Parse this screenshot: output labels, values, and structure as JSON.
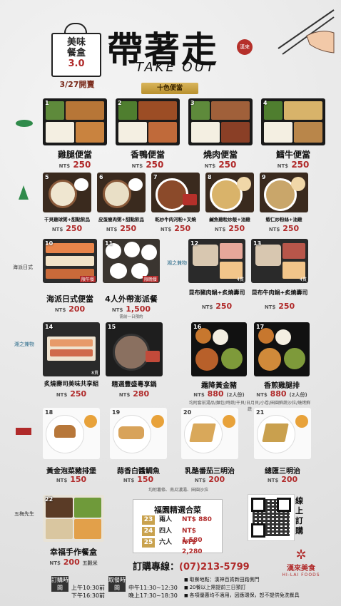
{
  "header": {
    "bag_line1": "美味",
    "bag_line2": "餐盒",
    "bag_line3": "3.0",
    "date": "3/27開賣",
    "title": "帶著走",
    "title_en": "TAKE OUT",
    "stamp": "漢來",
    "ribbon": "十色便當"
  },
  "row1": [
    {
      "num": "1",
      "name": "雞腿便當",
      "price": "250"
    },
    {
      "num": "2",
      "name": "香鴨便當",
      "price": "250"
    },
    {
      "num": "3",
      "name": "燒肉便當",
      "price": "250"
    },
    {
      "num": "4",
      "name": "鱈牛便當",
      "price": "250"
    }
  ],
  "row2": [
    {
      "num": "5",
      "name": "干貝雞球粥+甜點飲品",
      "price": "250"
    },
    {
      "num": "6",
      "name": "皮蛋瘦肉粥+甜點飲品",
      "price": "250"
    },
    {
      "num": "7",
      "name": "乾炒牛肉河粉+叉燒",
      "price": "250"
    },
    {
      "num": "8",
      "name": "鹹魚雞粒炒飯+油雞",
      "price": "250"
    },
    {
      "num": "9",
      "name": "蝦仁炒粉絲+油雞",
      "price": "250"
    }
  ],
  "row3": [
    {
      "num": "10",
      "name": "海派日式便當",
      "price": "200",
      "tag": "限午餐"
    },
    {
      "num": "11",
      "name": "4人外帶澎派餐",
      "price": "1,500",
      "tag": "限晚餐",
      "note": "需前一日預約"
    },
    {
      "num": "12",
      "name": "昆布豬肉鍋+炙燒壽司",
      "price": "250",
      "tag": "4貫"
    },
    {
      "num": "13",
      "name": "昆布牛肉鍋+炙燒壽司",
      "price": "250",
      "tag": "4貫"
    }
  ],
  "row4": [
    {
      "num": "14",
      "name": "炙燒壽司美味共享組",
      "price": "250",
      "tag": "8貫"
    },
    {
      "num": "15",
      "name": "精選豐盛粵享鍋",
      "price": "280"
    },
    {
      "num": "16",
      "name": "霜降黃金豬",
      "price": "880",
      "unit": "(2人份)"
    },
    {
      "num": "17",
      "name": "香煎雞腿排",
      "price": "880",
      "unit": "(2人份)"
    }
  ],
  "row4_note": "均附套前湯品/麵包/時蔬/干貝/日月貝/小卷/田園鮮蔬沙拉/燒烤鮮蔬",
  "row5": [
    {
      "num": "18",
      "name": "黃金泡菜豬排堡",
      "price": "150"
    },
    {
      "num": "19",
      "name": "蒜香白醬鯛魚",
      "price": "150"
    },
    {
      "num": "20",
      "name": "乳酪番茄三明治",
      "price": "200"
    },
    {
      "num": "21",
      "name": "總匯三明治",
      "price": "200"
    }
  ],
  "row5_note": "均附薯條、南瓜濃湯、田園沙拉",
  "bottom_left": {
    "num": "22",
    "name": "幸福手作餐盒",
    "price": "200",
    "unit": "五穀米"
  },
  "restaurant_logos": [
    "海派日式",
    "湘之兼物",
    "湘之兼物",
    "福園",
    "五梅先生"
  ],
  "combo": {
    "title": "福園精選合菜",
    "rows": [
      {
        "num": "23",
        "label": "兩人",
        "price": "880"
      },
      {
        "num": "24",
        "label": "四人",
        "price": "1,580"
      },
      {
        "num": "25",
        "label": "六人",
        "price": "2,280"
      }
    ]
  },
  "currency": "NT$",
  "order_online": "線上訂購",
  "hotline_label": "訂購專線：",
  "hotline": "(07)213-5799",
  "brand": {
    "zh": "漢來美食",
    "en": "HI-LAI FOODS"
  },
  "order_hours": {
    "label": "訂購時間",
    "am": "上午10:30前",
    "pm": "下午16:30前"
  },
  "pickup_hours": {
    "label": "取餐時間",
    "noon": "中午11:30~12:30",
    "eve": "晚上17:30~18:30"
  },
  "notes": [
    "取餐地點：漢神百貨新田路側門",
    "20餐以上需提前三日預訂",
    "各項優惠均不適用，因應環保，恕不提供免洗餐具"
  ],
  "colors": {
    "accent": "#b02a2a",
    "gold": "#c9a24e"
  }
}
